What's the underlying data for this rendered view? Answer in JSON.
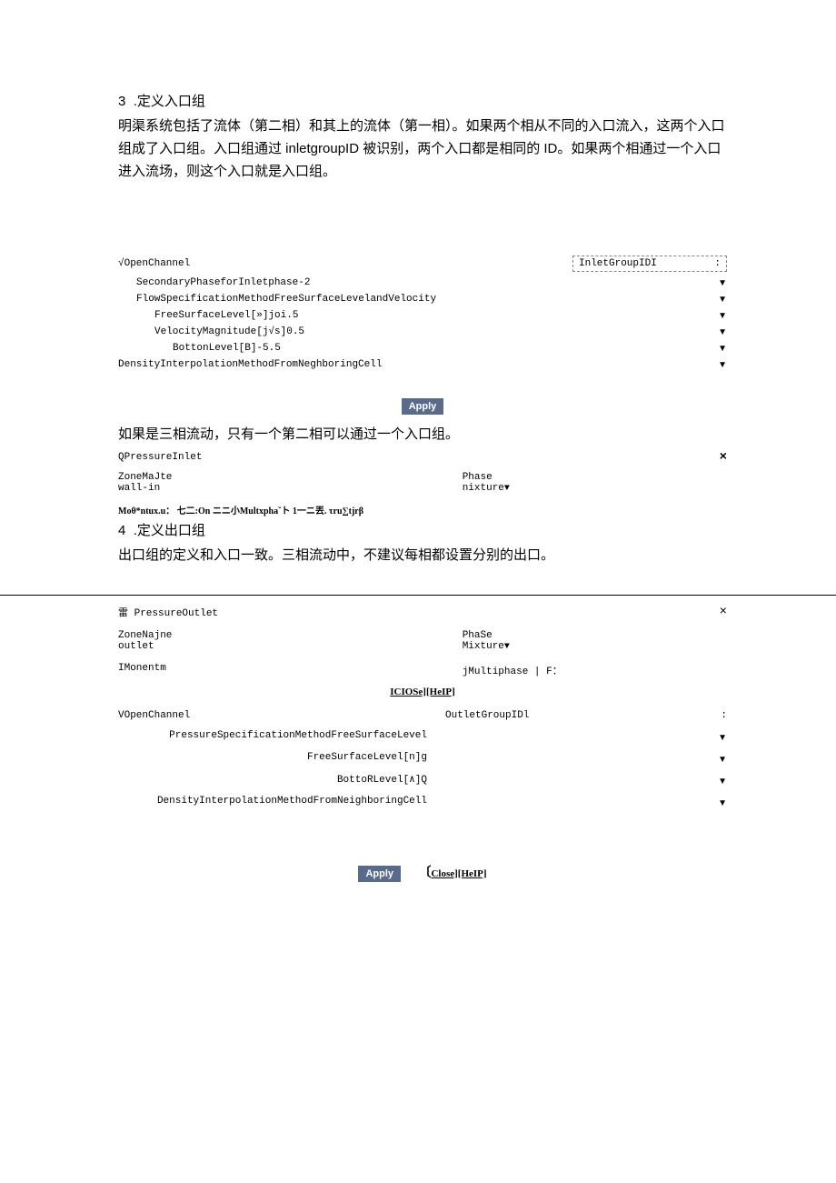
{
  "sec3": {
    "number": "3",
    "title": ".定义入口组",
    "body": "明渠系统包括了流体（第二相）和其上的流体（第一相）。如果两个相从不同的入口流入，这两个入口组成了入口组。入口组通过 inletgroupID 被识别，两个入口都是相同的 ID。如果两个相通过一个入口进入流场，则这个入口就是入口组。"
  },
  "inlet_panel": {
    "open_channel": "√OpenChannel",
    "inlet_group_label": "InletGroupIDI",
    "inlet_group_suffix": ":",
    "rows": [
      "SecondaryPhaseforInletphase-2",
      "FlowSpecificationMethodFreeSurfaceLevelandVelocity",
      "FreeSurfaceLevel[»]joi.5",
      "VelocityMagnitude[j√s]0.5",
      "BottonLevel[B]-5.5",
      "DensityInterpolationMethodFromNeghboringCell"
    ],
    "apply": "Apply"
  },
  "three_phase_note": "如果是三相流动，只有一个第二相可以通过一个入口组。",
  "pressure_inlet": {
    "title": "QPressureInlet",
    "close": "×",
    "zone_label": "ZoneMaJte",
    "zone_value": "wall-in",
    "phase_label": "Phase",
    "phase_value": "nixture",
    "tabs": "Moθ*ntux.u：      七二:On      ニニ小Multxphaˇト 1一ニ丟. τru∑tjrβ"
  },
  "sec4": {
    "number": "4",
    "title": ".定义出口组",
    "body": "出口组的定义和入口一致。三相流动中，不建议每相都设置分别的出口。"
  },
  "pressure_outlet": {
    "title_prefix": "雷 ",
    "title": "PressureOutlet",
    "close": "×",
    "zone_label": "ZoneNajne",
    "zone_value": "outlet",
    "phase_label": "PhaSe",
    "phase_value": "Mixture",
    "tab_left": "IMonentm",
    "tab_right": "jMultiphase | F：",
    "links": "ICIOSe][HeIP]",
    "open_channel": "VOpenChannel",
    "outlet_group": "OutletGroupIDl",
    "outlet_group_suffix": ":",
    "rows": [
      "PressureSpecificationMethodFreeSurfaceLevel",
      "FreeSurfaceLevel[n]g",
      "BottoRLevel[∧]Q",
      "DensityInterpolationMethodFromNeighboringCell"
    ],
    "apply": "Apply",
    "footer_links": "Close][HeIP]"
  }
}
